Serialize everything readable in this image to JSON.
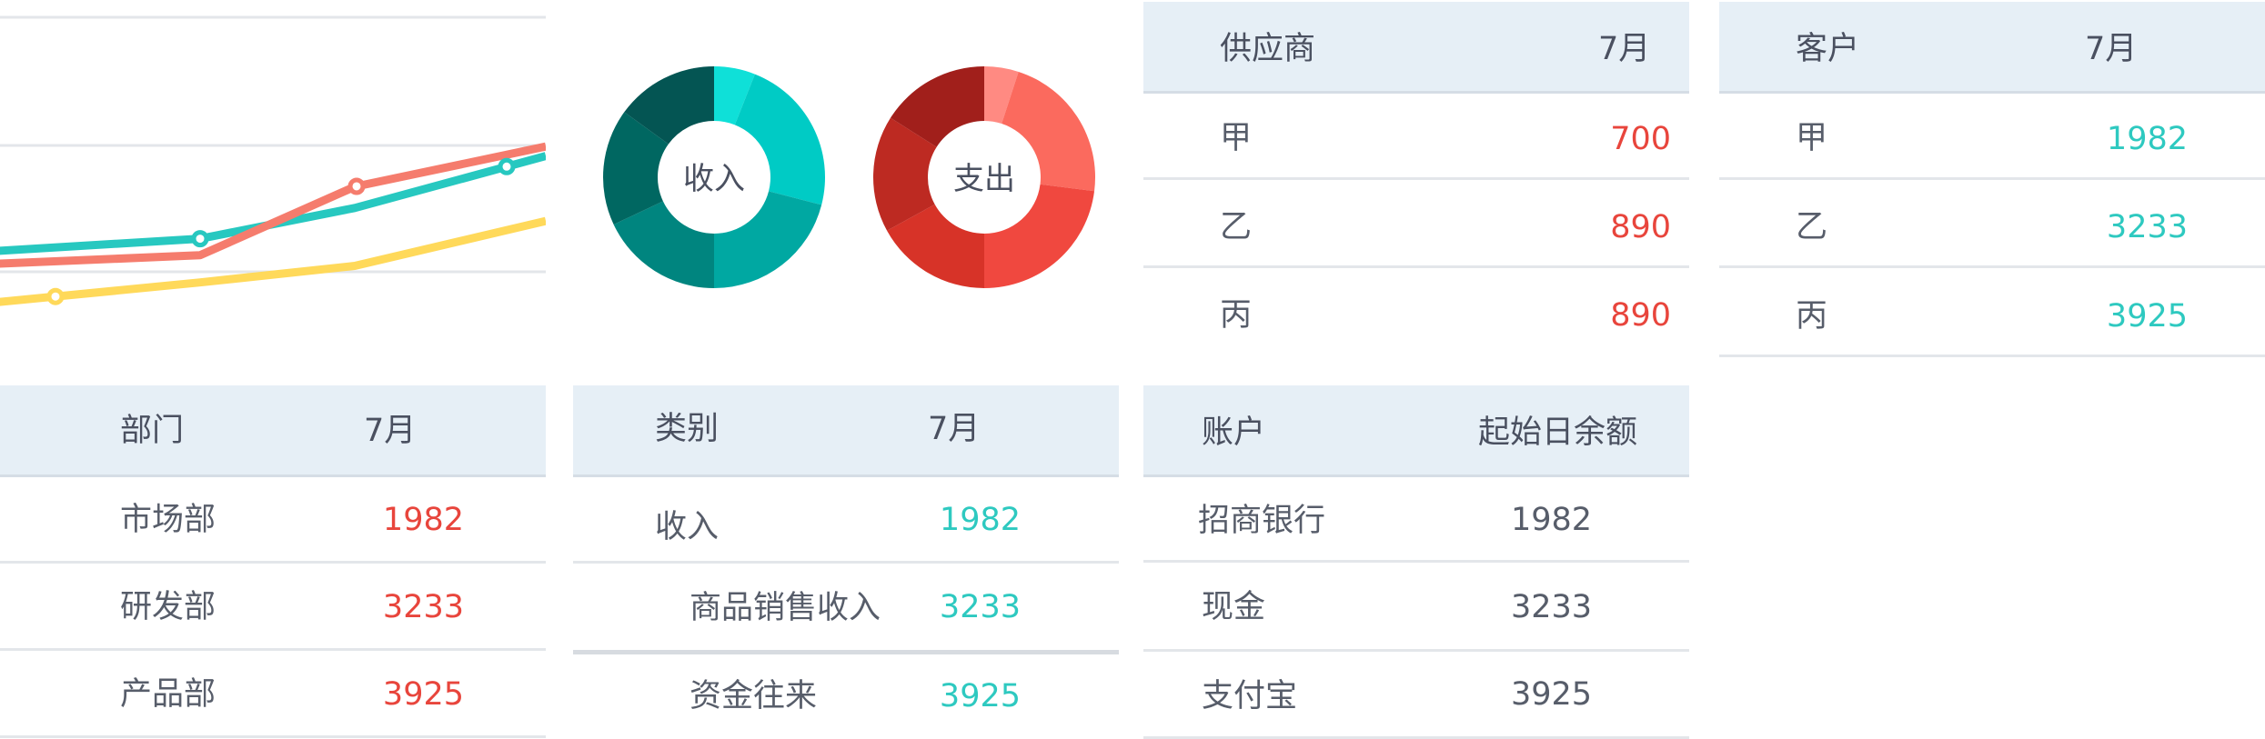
{
  "colors": {
    "header_bg": "#e6eff6",
    "red_value": "#e8453c",
    "teal_value": "#2ec9c0",
    "line_teal": "#27c8c0",
    "line_salmon": "#f57c6d",
    "line_yellow": "#ffd95a"
  },
  "line_chart": {
    "series": [
      {
        "color": "#27c8c0",
        "values": [
          15,
          28,
          54,
          98
        ]
      },
      {
        "color": "#f57c6d",
        "values": [
          5,
          14,
          72,
          106
        ]
      },
      {
        "color": "#ffd95a",
        "values": [
          -30,
          -9,
          5,
          43
        ]
      }
    ]
  },
  "donuts": [
    {
      "label": "收入",
      "slices": [
        {
          "value": 6,
          "color": "#0fe0d8"
        },
        {
          "value": 23,
          "color": "#00cbc5"
        },
        {
          "value": 21,
          "color": "#00a8a2"
        },
        {
          "value": 18,
          "color": "#00857f"
        },
        {
          "value": 17,
          "color": "#006761"
        },
        {
          "value": 15,
          "color": "#045553"
        }
      ]
    },
    {
      "label": "支出",
      "slices": [
        {
          "value": 5,
          "color": "#ff8a82"
        },
        {
          "value": 22,
          "color": "#fb6a5e"
        },
        {
          "value": 23,
          "color": "#f0483f"
        },
        {
          "value": 17,
          "color": "#d73328"
        },
        {
          "value": 17,
          "color": "#bd2a22"
        },
        {
          "value": 16,
          "color": "#a11f1b"
        }
      ]
    }
  ],
  "dept_table": {
    "headers": [
      "部门",
      "7月"
    ],
    "rows": [
      {
        "name": "市场部",
        "value": "1982"
      },
      {
        "name": "研发部",
        "value": "3233"
      },
      {
        "name": "产品部",
        "value": "3925"
      }
    ]
  },
  "category_table": {
    "headers": [
      "类别",
      "7月"
    ],
    "rows": [
      {
        "name": "收入",
        "value": "1982"
      },
      {
        "name": "商品销售收入",
        "value": "3233"
      },
      {
        "name": "资金往来",
        "value": "3925"
      }
    ]
  },
  "supplier_table": {
    "headers": [
      "供应商",
      "7月"
    ],
    "rows": [
      {
        "name": "甲",
        "value": "700"
      },
      {
        "name": "乙",
        "value": "890"
      },
      {
        "name": "丙",
        "value": "890"
      }
    ]
  },
  "account_table": {
    "headers": [
      "账户",
      "起始日余额"
    ],
    "rows": [
      {
        "name": "招商银行",
        "value": "1982"
      },
      {
        "name": "现金",
        "value": "3233"
      },
      {
        "name": "支付宝",
        "value": "3925"
      }
    ]
  },
  "customer_table": {
    "headers": [
      "客户",
      "7月"
    ],
    "rows": [
      {
        "name": "甲",
        "value": "1982"
      },
      {
        "name": "乙",
        "value": "3233"
      },
      {
        "name": "丙",
        "value": "3925"
      }
    ]
  }
}
